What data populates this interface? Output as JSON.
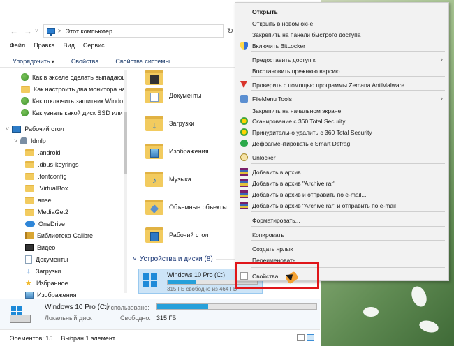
{
  "address": {
    "path": "Этот компьютер"
  },
  "menubar": [
    "Файл",
    "Правка",
    "Вид",
    "Сервис"
  ],
  "toolbar": {
    "organize": "Упорядочить",
    "properties": "Свойства",
    "system_properties": "Свойства системы"
  },
  "nav": {
    "recent": [
      "Как в экселе сделать выпадающ",
      "Как настроить два монитора на",
      "Как отключить защитник Windo",
      "Как узнать какой диск SSD или H"
    ],
    "desktop": "Рабочий стол",
    "user": "ldmlp",
    "user_folders": [
      ".android",
      ".dbus-keyrings",
      ".fontconfig",
      ".VirtualBox",
      "ansel",
      "MediaGet2"
    ],
    "onedrive": "OneDrive",
    "libraries": [
      {
        "label": "Библиотека Calibre",
        "icon": "library-icon"
      },
      {
        "label": "Видео",
        "icon": "video-icon"
      },
      {
        "label": "Документы",
        "icon": "documents-icon"
      },
      {
        "label": "Загрузки",
        "icon": "downloads-icon"
      },
      {
        "label": "Избранное",
        "icon": "star-icon"
      },
      {
        "label": "Изображения",
        "icon": "images-icon"
      }
    ]
  },
  "content": {
    "folders": [
      "Документы",
      "Загрузки",
      "Изображения",
      "Музыка",
      "Объемные объекты",
      "Рабочий стол"
    ],
    "section": "Устройства и диски (8)",
    "drive": {
      "name": "Windows 10 Pro (C:)",
      "free": "315 ГБ свободно из 464 ГБ",
      "used_fraction": 0.32
    }
  },
  "details": {
    "title": "Windows 10 Pro (C:)",
    "type": "Локальный диск",
    "used_label": "Использовано:",
    "free_label": "Свободно:",
    "free_value": "315 ГБ",
    "used_fraction": 0.32
  },
  "status": {
    "count": "Элементов: 15",
    "selected": "Выбран 1 элемент"
  },
  "context_menu": {
    "items": [
      {
        "label": "Открыть",
        "bold": true
      },
      {
        "label": "Открыть в новом окне"
      },
      {
        "label": "Закрепить на панели быстрого доступа"
      },
      {
        "label": "Включить BitLocker",
        "icon": "bitlocker-shield-icon"
      },
      {
        "label": "Предоставить доступ к",
        "submenu": true
      },
      {
        "label": "Восстановить прежнюю версию"
      },
      {
        "label": "Проверить с помощью программы Zemana AntiMalware",
        "icon": "zemana-icon"
      },
      {
        "label": "FileMenu Tools",
        "icon": "filemenu-tools-icon",
        "submenu": true
      },
      {
        "label": "Закрепить на начальном экране"
      },
      {
        "label": "Сканирование с 360 Total Security",
        "icon": "360-security-icon"
      },
      {
        "label": "Принудительно удалить с  360 Total Security",
        "icon": "360-security-icon"
      },
      {
        "label": "Дефрагментировать с Smart Defrag",
        "icon": "smart-defrag-icon"
      },
      {
        "label": "Unlocker",
        "icon": "unlocker-icon"
      },
      {
        "label": "Добавить в архив...",
        "icon": "winrar-icon"
      },
      {
        "label": "Добавить в архив \"Archive.rar\"",
        "icon": "winrar-icon"
      },
      {
        "label": "Добавить в архив и отправить по e-mail...",
        "icon": "winrar-icon"
      },
      {
        "label": "Добавить в архив \"Archive.rar\" и отправить по e-mail",
        "icon": "winrar-icon"
      },
      {
        "label": "Форматировать..."
      },
      {
        "label": "Копировать"
      },
      {
        "label": "Создать ярлык"
      },
      {
        "label": "Переименовать"
      },
      {
        "label": "Свойства",
        "icon": "properties-icon",
        "highlighted": true
      }
    ]
  },
  "colors": {
    "accent": "#26a0da",
    "highlight": "#e0161a",
    "selection": "#cce4f7"
  }
}
